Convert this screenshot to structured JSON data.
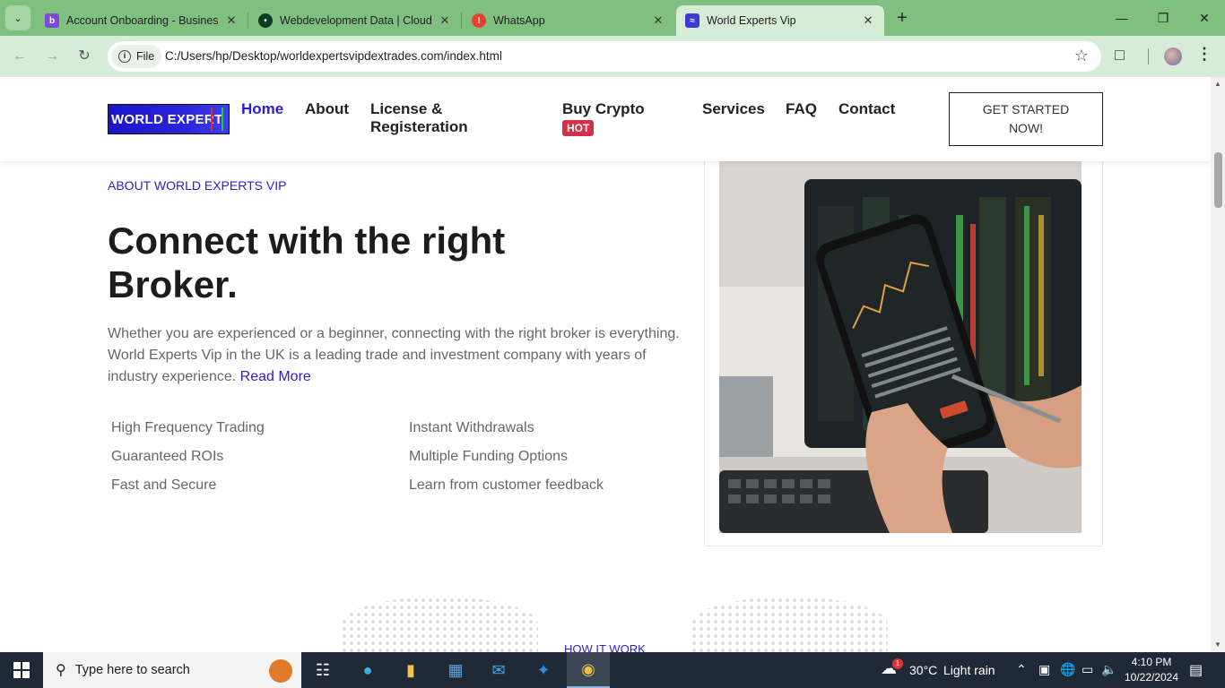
{
  "browser": {
    "tabs": [
      {
        "title": "Account Onboarding - Business",
        "favicon_color": "#7b4ad8",
        "favicon_glyph": "b"
      },
      {
        "title": "Webdevelopment Data | Cloud",
        "favicon_color": "#0b3d1f",
        "favicon_glyph": "•"
      },
      {
        "title": "WhatsApp",
        "favicon_color": "#e8402b",
        "favicon_glyph": "!"
      },
      {
        "title": "World Experts Vip",
        "favicon_color": "#3a3ad6",
        "favicon_glyph": "≈"
      }
    ],
    "active_tab_index": 3,
    "scheme_chip": "File",
    "url": "C:/Users/hp/Desktop/worldexpertsvipdextrades.com/index.html"
  },
  "site": {
    "logo_text": "WORLD EXPERT",
    "nav": [
      {
        "label": "Home",
        "active": true
      },
      {
        "label": "About"
      },
      {
        "label": "License &"
      },
      {
        "label": "Registeration"
      },
      {
        "label": "Buy Crypto"
      },
      {
        "label": "Services"
      },
      {
        "label": "FAQ"
      },
      {
        "label": "Contact"
      }
    ],
    "hot_badge": "HOT",
    "cta_line1": "GET STARTED",
    "cta_line2": "NOW!"
  },
  "about": {
    "eyebrow": "ABOUT WORLD EXPERTS VIP",
    "headline_line1": "Connect with the right",
    "headline_line2": "Broker.",
    "body": "Whether you are experienced or a beginner, connecting with the right broker is everything. World Experts Vip in the UK is a leading trade and investment company with years of industry experience.",
    "read_more": "Read More",
    "features": [
      "High Frequency Trading",
      "Guaranteed ROIs",
      "Fast and Secure",
      "Instant Withdrawals",
      "Multiple Funding Options",
      "Learn from customer feedback"
    ]
  },
  "next_section_label": "HOW IT WORK",
  "taskbar": {
    "search_placeholder": "Type here to search",
    "weather_temp": "30°C",
    "weather_desc": "Light rain",
    "weather_badge": "1",
    "time": "4:10 PM",
    "date": "10/22/2024"
  },
  "colors": {
    "accent": "#2b1cd1",
    "hot": "#d3304a",
    "browser_frame": "#7fbf7f",
    "taskbar": "#1f2a36"
  }
}
